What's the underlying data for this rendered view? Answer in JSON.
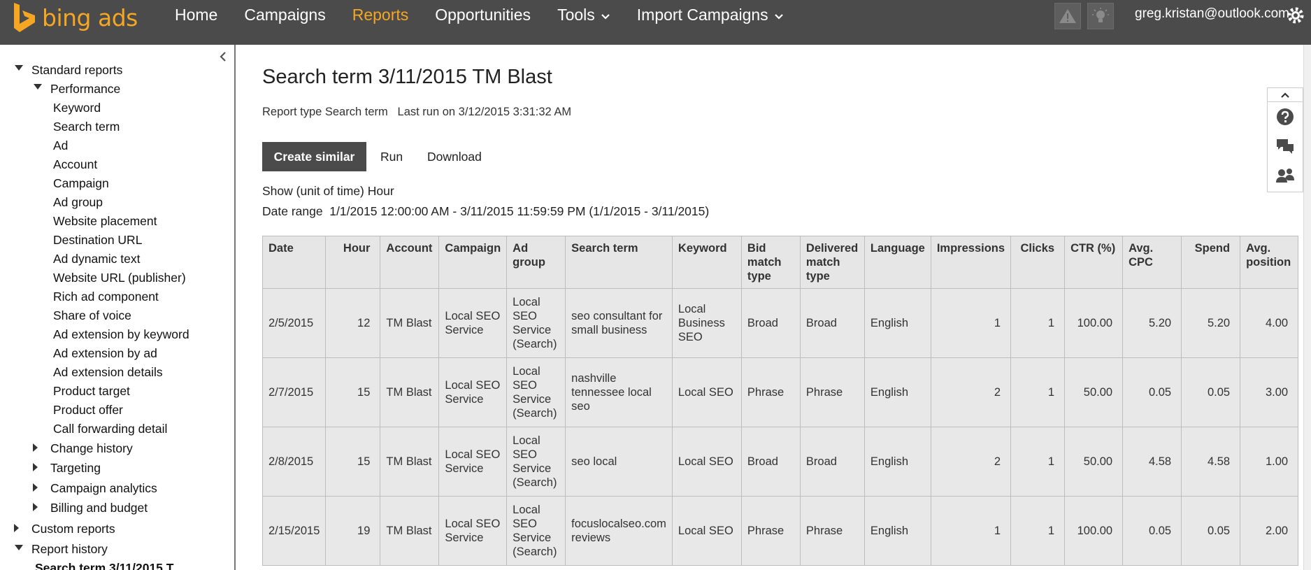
{
  "brand": {
    "name": "bing ads",
    "color": "#f5a623",
    "icon": "bing-logo-icon"
  },
  "nav": {
    "items": [
      {
        "label": "Home",
        "active": false
      },
      {
        "label": "Campaigns",
        "active": false
      },
      {
        "label": "Reports",
        "active": true
      },
      {
        "label": "Opportunities",
        "active": false
      },
      {
        "label": "Tools",
        "active": false,
        "dropdown": true
      },
      {
        "label": "Import Campaigns",
        "active": false,
        "dropdown": true
      }
    ],
    "alert_icon": "warning-icon",
    "idea_icon": "lightbulb-icon",
    "user": "greg.kristan@outlook.com",
    "settings_icon": "gear-icon"
  },
  "sidebar": {
    "collapse_icon": "chevron-left-icon",
    "standard_reports": "Standard reports",
    "performance": "Performance",
    "performance_items": [
      "Keyword",
      "Search term",
      "Ad",
      "Account",
      "Campaign",
      "Ad group",
      "Website placement",
      "Destination URL",
      "Ad dynamic text",
      "Website URL (publisher)",
      "Rich ad component",
      "Share of voice",
      "Ad extension by keyword",
      "Ad extension by ad",
      "Ad extension details",
      "Product target",
      "Product offer",
      "Call forwarding detail"
    ],
    "groups": [
      "Change history",
      "Targeting",
      "Campaign analytics",
      "Billing and budget"
    ],
    "custom_reports": "Custom reports",
    "report_history": "Report history",
    "history_item": "Search term 3/11/2015 T"
  },
  "report": {
    "title": "Search term 3/11/2015 TM Blast",
    "report_type": "Report type Search term",
    "last_run": "Last run on 3/12/2015 3:31:32 AM",
    "create_similar": "Create similar",
    "run": "Run",
    "download": "Download",
    "unit_of_time": "Show (unit of time) Hour",
    "date_range": "Date range  1/1/2015 12:00:00 AM - 3/11/2015 11:59:59 PM (1/1/2015 - 3/11/2015)"
  },
  "table": {
    "columns": [
      "Date",
      "Hour",
      "Account",
      "Campaign",
      "Ad group",
      "Search term",
      "Keyword",
      "Bid match type",
      "Delivered match type",
      "Language",
      "Impressions",
      "Clicks",
      "CTR (%)",
      "Avg. CPC",
      "Spend",
      "Avg. position"
    ],
    "rows": [
      [
        "2/5/2015",
        "12",
        "TM Blast",
        "Local SEO Service",
        "Local SEO Service (Search)",
        "seo consultant for small business",
        "Local Business SEO",
        "Broad",
        "Broad",
        "English",
        "1",
        "1",
        "100.00",
        "5.20",
        "5.20",
        "4.00"
      ],
      [
        "2/7/2015",
        "15",
        "TM Blast",
        "Local SEO Service",
        "Local SEO Service (Search)",
        "nashville tennessee local seo",
        "Local SEO",
        "Phrase",
        "Phrase",
        "English",
        "2",
        "1",
        "50.00",
        "0.05",
        "0.05",
        "3.00"
      ],
      [
        "2/8/2015",
        "15",
        "TM Blast",
        "Local SEO Service",
        "Local SEO Service (Search)",
        "seo local",
        "Local SEO",
        "Broad",
        "Broad",
        "English",
        "2",
        "1",
        "50.00",
        "4.58",
        "4.58",
        "1.00"
      ],
      [
        "2/15/2015",
        "19",
        "TM Blast",
        "Local SEO Service",
        "Local SEO Service (Search)",
        "focuslocalseo.com reviews",
        "Local SEO",
        "Phrase",
        "Phrase",
        "English",
        "1",
        "1",
        "100.00",
        "0.05",
        "0.05",
        "2.00"
      ]
    ]
  },
  "side_panel": {
    "icons": [
      "chevron-up-icon",
      "help-icon",
      "chat-icon",
      "people-icon"
    ]
  }
}
